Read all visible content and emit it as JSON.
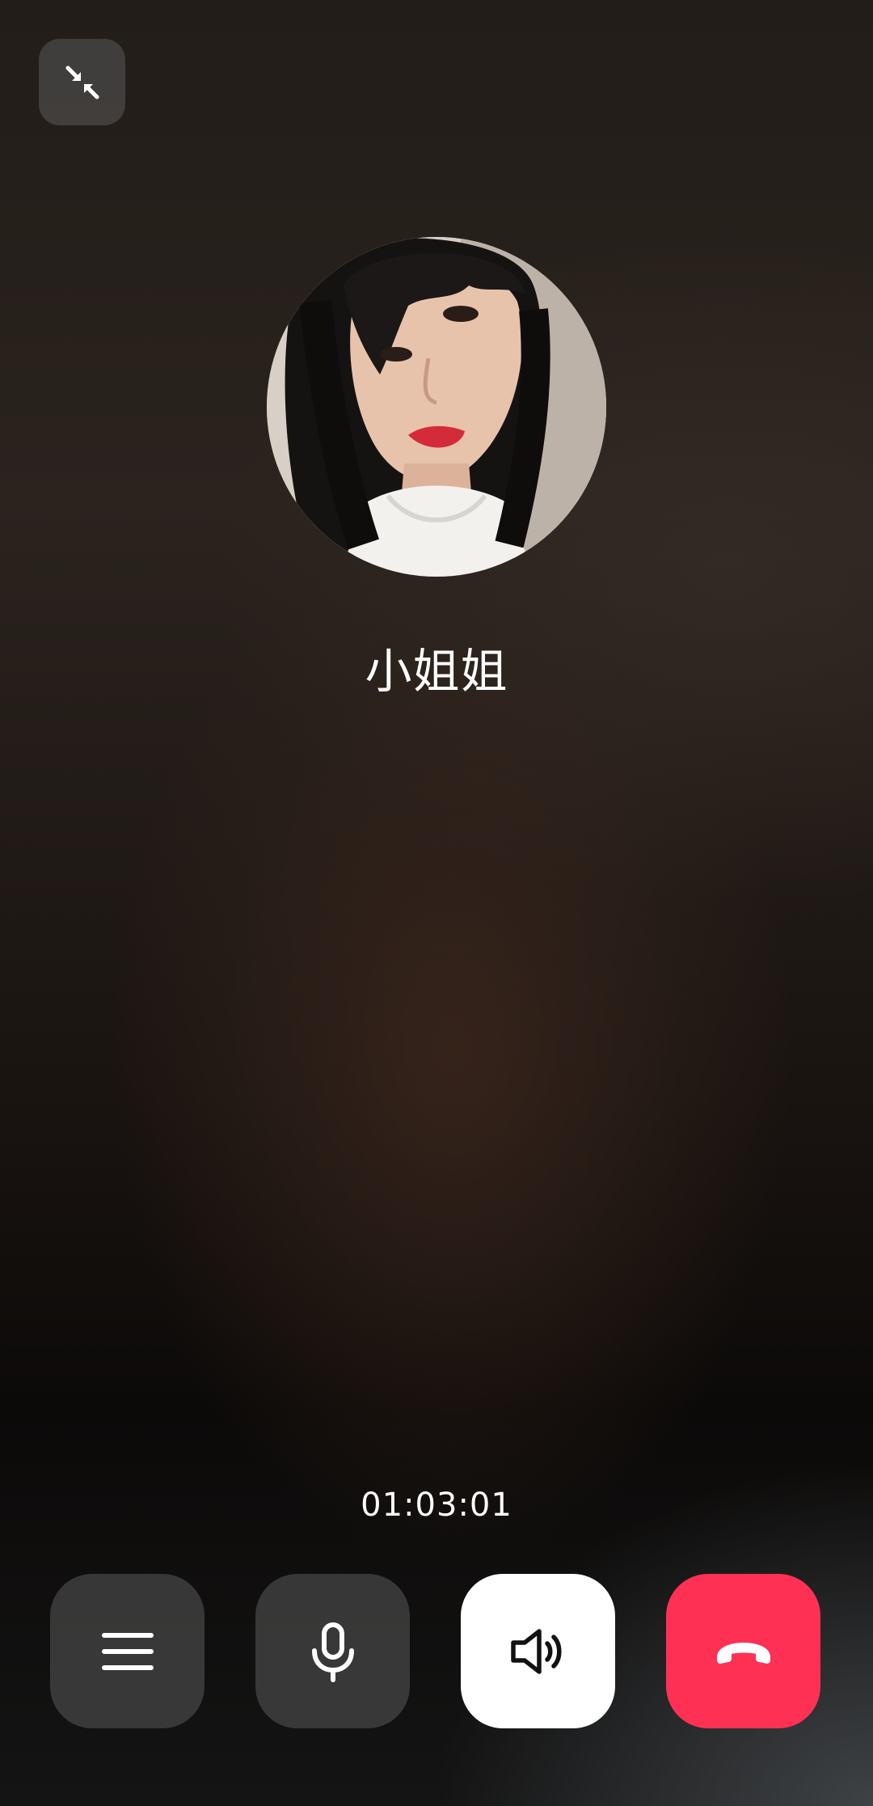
{
  "call": {
    "caller_name": "小姐姐",
    "duration": "01:03:01"
  },
  "icons": {
    "minimize": "minimize-icon",
    "menu": "menu-icon",
    "microphone": "microphone-icon",
    "speaker": "speaker-icon",
    "hangup": "hangup-icon"
  },
  "colors": {
    "hangup": "#fe3155",
    "speaker_active": "#ffffff",
    "control_inactive": "#464646"
  }
}
